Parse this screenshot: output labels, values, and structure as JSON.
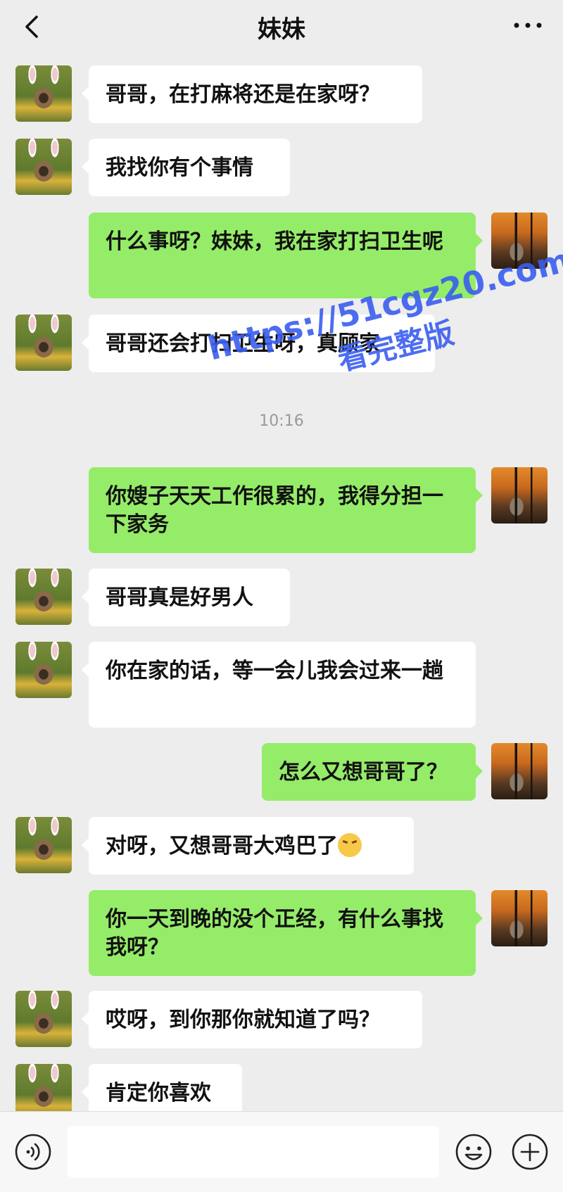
{
  "header": {
    "title": "妹妹"
  },
  "messages": [
    {
      "side": "left",
      "text": "哥哥，在打麻将还是在家呀？"
    },
    {
      "side": "left",
      "text": "我找你有个事情"
    },
    {
      "side": "right",
      "text": "什么事呀？妹妹，我在家打扫卫生呢"
    },
    {
      "side": "left",
      "text": "哥哥还会打扫卫生呀，真顾家"
    },
    {
      "side": "right",
      "text": "你嫂子天天工作很累的，我得分担一下家务"
    },
    {
      "side": "left",
      "text": "哥哥真是好男人"
    },
    {
      "side": "left",
      "text": "你在家的话，等一会儿我会过来一趟"
    },
    {
      "side": "right",
      "text": "怎么又想哥哥了？"
    },
    {
      "side": "left",
      "text": "对呀，又想哥哥大鸡巴了"
    },
    {
      "side": "right",
      "text": "你一天到晚的没个正经，有什么事找我呀？"
    },
    {
      "side": "left",
      "text": "哎呀，到你那你就知道了吗？"
    },
    {
      "side": "left",
      "text": "肯定你喜欢"
    }
  ],
  "timestamp": "10:16",
  "watermark": {
    "url": "https://51cgz20.com",
    "subtitle": "看完整版"
  },
  "input": {
    "placeholder": ""
  },
  "icons": {
    "back": "chevron-left-icon",
    "more": "more-dots-icon",
    "voice": "voice-icon",
    "emoji": "emoji-icon",
    "plus": "plus-icon"
  }
}
